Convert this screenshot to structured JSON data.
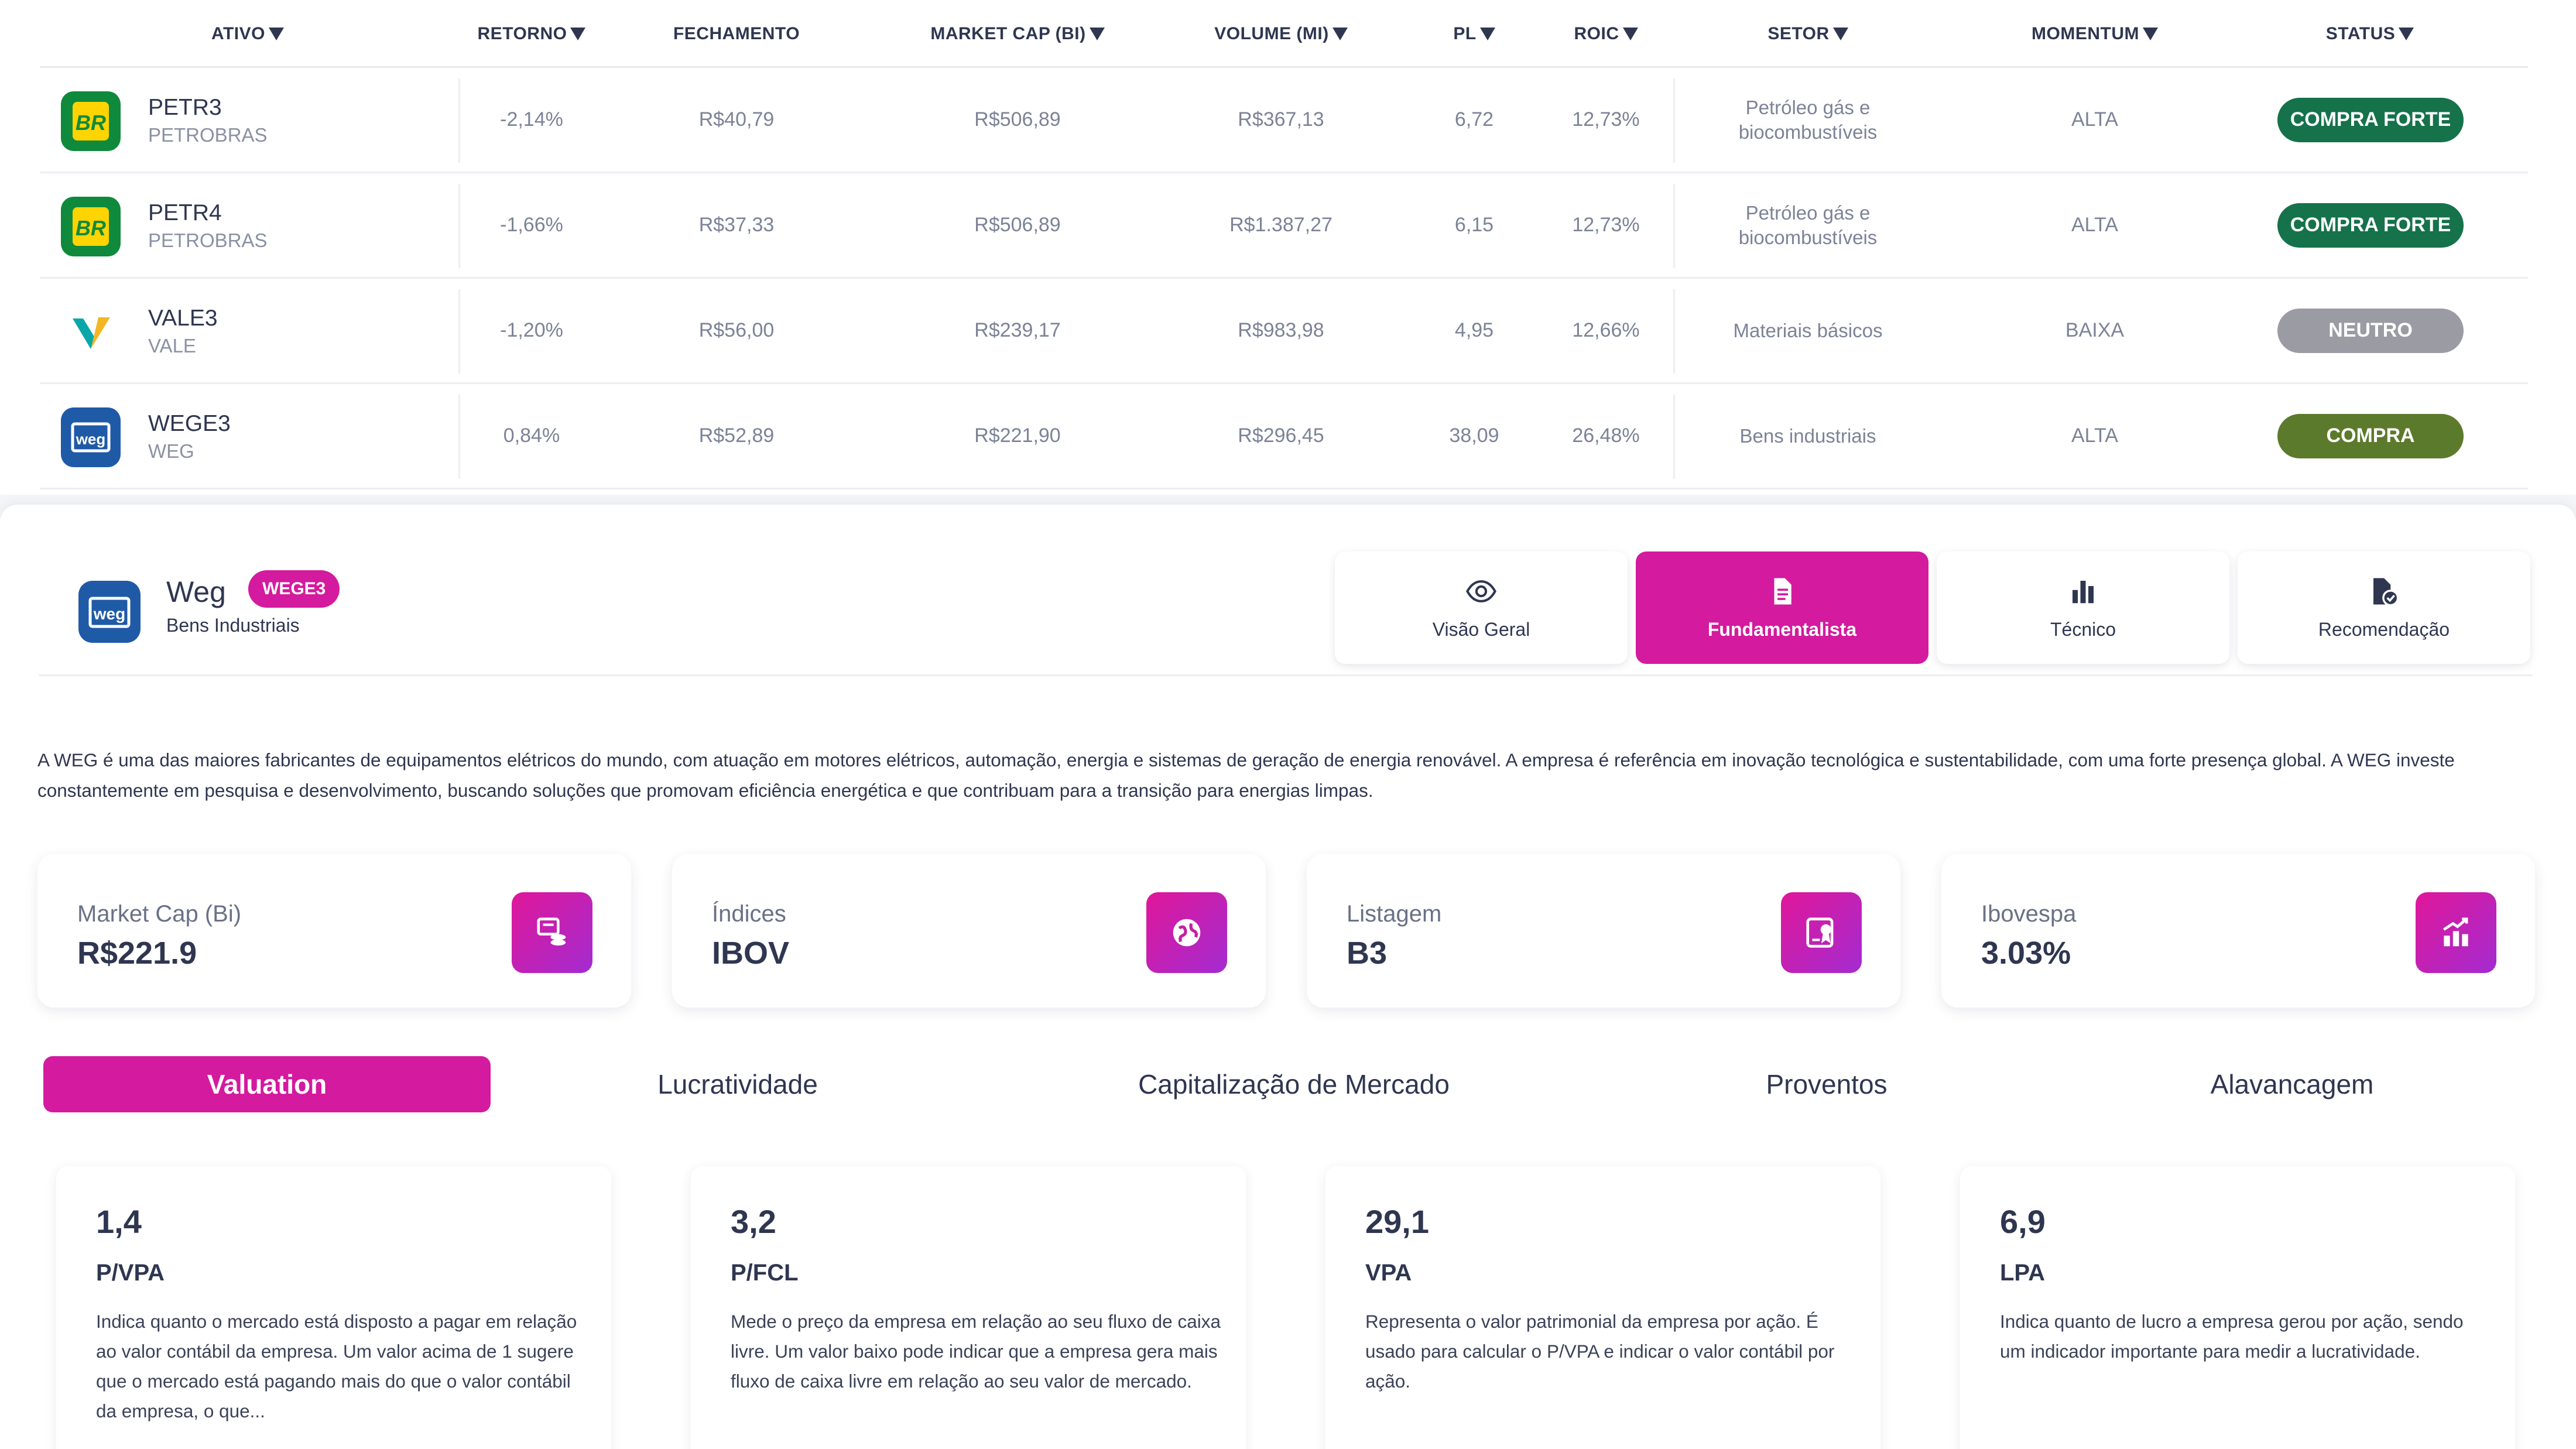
{
  "table": {
    "headers": {
      "ativo": "ATIVO",
      "retorno": "RETORNO",
      "fechamento": "FECHAMENTO",
      "market_cap": "MARKET CAP (BI)",
      "volume": "VOLUME (MI)",
      "pl": "PL",
      "roic": "ROIC",
      "setor": "SETOR",
      "momentum": "MOMENTUM",
      "status": "STATUS"
    },
    "rows": [
      {
        "ticker": "PETR3",
        "name": "PETROBRAS",
        "logo": "petrobras-logo",
        "retorno": "-2,14%",
        "fechamento": "R$40,79",
        "market_cap": "R$506,89",
        "volume": "R$367,13",
        "pl": "6,72",
        "roic": "12,73%",
        "setor": "Petróleo gás e biocombustíveis",
        "momentum": "ALTA",
        "status": "COMPRA FORTE",
        "status_color": "#15724a"
      },
      {
        "ticker": "PETR4",
        "name": "PETROBRAS",
        "logo": "petrobras-logo",
        "retorno": "-1,66%",
        "fechamento": "R$37,33",
        "market_cap": "R$506,89",
        "volume": "R$1.387,27",
        "pl": "6,15",
        "roic": "12,73%",
        "setor": "Petróleo gás e biocombustíveis",
        "momentum": "ALTA",
        "status": "COMPRA FORTE",
        "status_color": "#15724a"
      },
      {
        "ticker": "VALE3",
        "name": "VALE",
        "logo": "vale-logo",
        "retorno": "-1,20%",
        "fechamento": "R$56,00",
        "market_cap": "R$239,17",
        "volume": "R$983,98",
        "pl": "4,95",
        "roic": "12,66%",
        "setor": "Materiais básicos",
        "momentum": "BAIXA",
        "status": "NEUTRO",
        "status_color": "#9b9ca3"
      },
      {
        "ticker": "WEGE3",
        "name": "WEG",
        "logo": "weg-logo",
        "retorno": "0,84%",
        "fechamento": "R$52,89",
        "market_cap": "R$221,90",
        "volume": "R$296,45",
        "pl": "38,09",
        "roic": "26,48%",
        "setor": "Bens industriais",
        "momentum": "ALTA",
        "status": "COMPRA",
        "status_color": "#5c7a2c"
      }
    ]
  },
  "company": {
    "name": "Weg",
    "ticker": "WEGE3",
    "sector": "Bens Industriais",
    "logo": "weg-logo"
  },
  "view_tabs": [
    {
      "label": "Visão Geral",
      "icon": "eye-icon",
      "active": false
    },
    {
      "label": "Fundamentalista",
      "icon": "document-icon",
      "active": true
    },
    {
      "label": "Técnico",
      "icon": "bar-chart-icon",
      "active": false
    },
    {
      "label": "Recomendação",
      "icon": "document-check-icon",
      "active": false
    }
  ],
  "description": "A WEG é uma das maiores fabricantes de equipamentos elétricos do mundo, com atuação em motores elétricos, automação, energia e sistemas de geração de energia renovável. A empresa é referência em inovação tecnológica e sustentabilidade, com uma forte presença global. A WEG investe constantemente em pesquisa e desenvolvimento, buscando soluções que promovam eficiência energética e que contribuam para a transição para energias limpas.",
  "kpis": [
    {
      "label": "Market Cap (Bi)",
      "value": "R$221.9",
      "icon": "coins-icon"
    },
    {
      "label": "Índices",
      "value": "IBOV",
      "icon": "globe-icon"
    },
    {
      "label": "Listagem",
      "value": "B3",
      "icon": "badge-icon"
    },
    {
      "label": "Ibovespa",
      "value": "3.03%",
      "icon": "chart-up-icon"
    }
  ],
  "sub_tabs": [
    {
      "label": "Valuation",
      "active": true
    },
    {
      "label": "Lucratividade",
      "active": false
    },
    {
      "label": "Capitalização de Mercado",
      "active": false
    },
    {
      "label": "Proventos",
      "active": false
    },
    {
      "label": "Alavancagem",
      "active": false
    }
  ],
  "metrics": [
    {
      "value": "1,4",
      "name": "P/VPA",
      "desc": "Indica quanto o mercado está disposto a pagar em relação ao valor contábil da empresa. Um valor acima de 1 sugere que o mercado está pagando mais do que o valor contábil da empresa, o que..."
    },
    {
      "value": "3,2",
      "name": "P/FCL",
      "desc": "Mede o preço da empresa em relação ao seu fluxo de caixa livre. Um valor baixo pode indicar que a empresa gera mais fluxo de caixa livre em relação ao seu valor de mercado."
    },
    {
      "value": "29,1",
      "name": "VPA",
      "desc": "Representa o valor patrimonial da empresa por ação. É usado para calcular o P/VPA e indicar o valor contábil por ação."
    },
    {
      "value": "6,9",
      "name": "LPA",
      "desc": "Indica quanto de lucro a empresa gerou por ação, sendo um indicador importante para medir a lucratividade."
    }
  ]
}
